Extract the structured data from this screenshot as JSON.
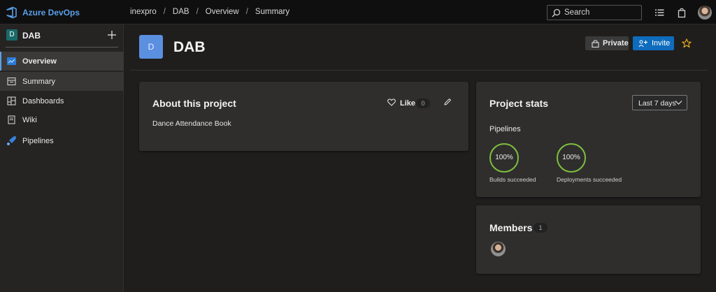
{
  "topbar": {
    "brand": "Azure DevOps",
    "breadcrumb": [
      "inexpro",
      "DAB",
      "Overview",
      "Summary"
    ],
    "search_placeholder": "Search",
    "icons": [
      "list-icon",
      "shopping-bag-icon"
    ]
  },
  "sidebar": {
    "project_initial": "D",
    "project_name": "DAB",
    "items": [
      {
        "label": "Overview",
        "icon": "overview-icon"
      },
      {
        "label": "Summary",
        "icon": "summary-icon"
      },
      {
        "label": "Dashboards",
        "icon": "dashboards-icon"
      },
      {
        "label": "Wiki",
        "icon": "wiki-icon"
      },
      {
        "label": "Pipelines",
        "icon": "pipelines-icon"
      }
    ]
  },
  "header": {
    "avatar_initial": "D",
    "title": "DAB",
    "private_label": "Private",
    "invite_label": "Invite"
  },
  "about": {
    "title": "About this project",
    "like_label": "Like",
    "like_count": "0",
    "description": "Dance Attendance Book"
  },
  "stats": {
    "title": "Project stats",
    "range": "Last 7 days",
    "section": "Pipelines",
    "builds_value": "100%",
    "builds_caption": "Builds succeeded",
    "deploy_value": "100%",
    "deploy_caption": "Deployments succeeded"
  },
  "members": {
    "title": "Members",
    "count": "1"
  },
  "colors": {
    "accent": "#0f6cbd",
    "brand": "#5aa0e8",
    "success_ring": "#7fbf3f",
    "star": "#f2b01e"
  }
}
